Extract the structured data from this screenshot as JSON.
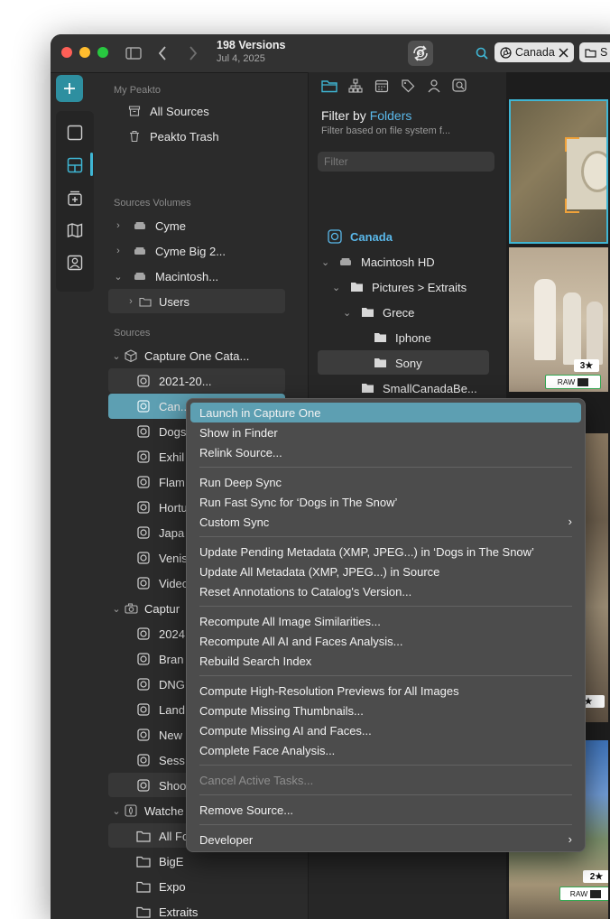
{
  "titlebar": {
    "title": "198 Versions",
    "subtitle": "Jul 4, 2025",
    "sync_badge": "3",
    "tag_canada": "Canada",
    "tag_second": "S"
  },
  "sidebar": {
    "my_peakto_header": "My Peakto",
    "all_sources": "All Sources",
    "peakto_trash": "Peakto Trash",
    "volumes_header": "Sources Volumes",
    "volumes": [
      {
        "label": "Cyme"
      },
      {
        "label": "Cyme Big 2..."
      },
      {
        "label": "Macintosh..."
      }
    ],
    "users": "Users",
    "sources_header": "Sources",
    "capture_catalog": "Capture One Cata...",
    "catalog_items": [
      {
        "label": "2021-20..."
      },
      {
        "label": "Can..."
      },
      {
        "label": "Dogs in"
      },
      {
        "label": "Exhil"
      },
      {
        "label": "Flam"
      },
      {
        "label": "Hortu"
      },
      {
        "label": "Japa"
      },
      {
        "label": "Venis"
      },
      {
        "label": "Video"
      }
    ],
    "capture_second": "Captur",
    "second_items": [
      {
        "label": "2024"
      },
      {
        "label": "Bran"
      },
      {
        "label": "DNG"
      },
      {
        "label": "Land"
      },
      {
        "label": "New"
      },
      {
        "label": "Sess"
      },
      {
        "label": "Shoo"
      }
    ],
    "watched": "Watche",
    "watched_items": [
      {
        "label": "All Fo"
      },
      {
        "label": "BigE"
      },
      {
        "label": "Expo"
      },
      {
        "label": "Extraits"
      }
    ]
  },
  "filter": {
    "title_prefix": "Filter by ",
    "title_accent": "Folders",
    "subtitle": "Filter based on file system f...",
    "placeholder": "Filter",
    "canada": "Canada",
    "macintosh": "Macintosh HD",
    "pictures": "Pictures > Extraits",
    "grece": "Grece",
    "iphone": "Iphone",
    "sony": "Sony",
    "smallcanada": "SmallCanadaBe..."
  },
  "thumbs": {
    "rating1": "3",
    "raw1": "RAW",
    "rating2": "2",
    "raw2": "RAW"
  },
  "menu": {
    "items": [
      "Launch in Capture One",
      "Show in Finder",
      "Relink Source...",
      "Run Deep Sync",
      "Run Fast Sync for ‘Dogs in The Snow’",
      "Custom Sync",
      "Update Pending Metadata (XMP, JPEG...) in ‘Dogs in The Snow’",
      "Update All Metadata (XMP, JPEG...) in Source",
      "Reset Annotations to Catalog's Version...",
      "Recompute All Image Similarities...",
      "Recompute All AI and Faces Analysis...",
      "Rebuild Search Index",
      "Compute High-Resolution Previews for All Images",
      "Compute Missing Thumbnails...",
      "Compute Missing AI and Faces...",
      "Complete Face Analysis...",
      "Cancel Active Tasks...",
      "Remove Source...",
      "Developer"
    ]
  },
  "colors": {
    "accent": "#2e8fa0",
    "highlight": "#5d9fb2",
    "green_dot": "#2ecc40",
    "folders_accent": "#5ab8ea"
  }
}
